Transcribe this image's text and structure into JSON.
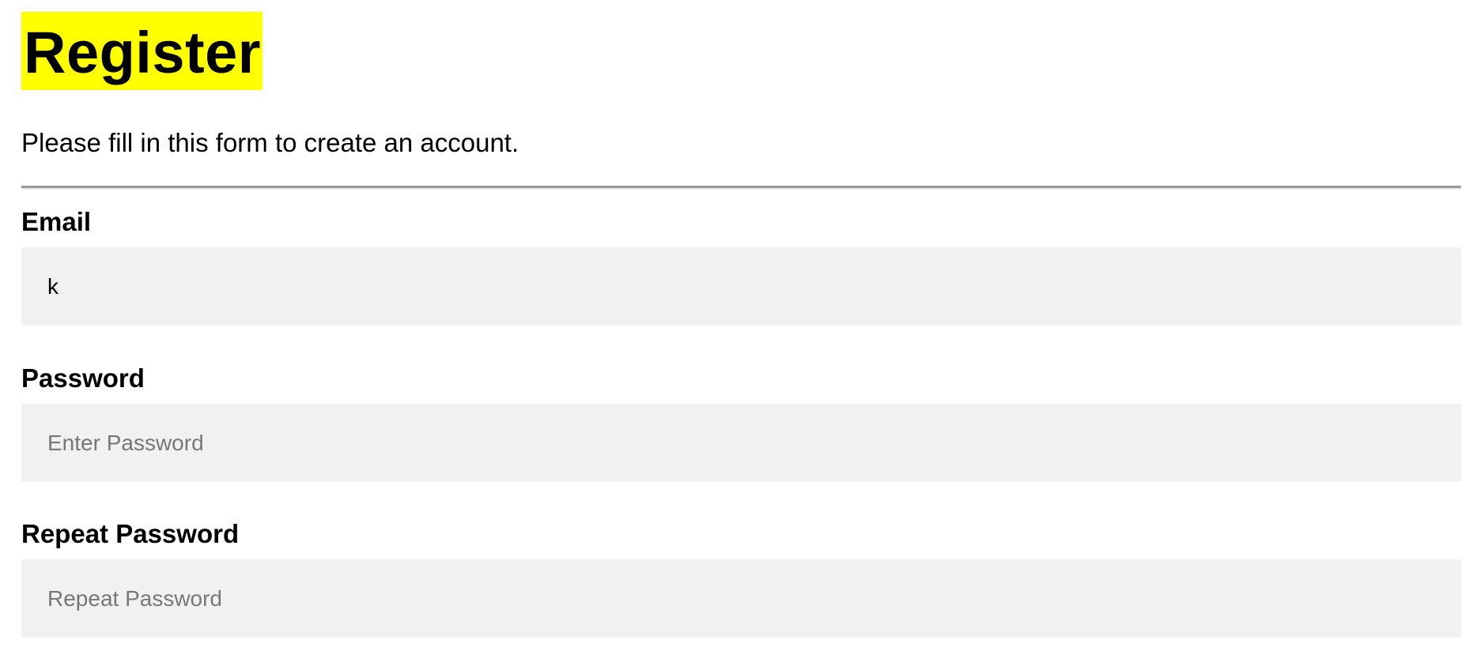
{
  "form": {
    "title": "Register",
    "subtitle": "Please fill in this form to create an account.",
    "colors": {
      "title_highlight": "#ffff00",
      "field_background": "#f1f1f1",
      "placeholder_text": "#777777",
      "divider": "#999999"
    },
    "fields": {
      "email": {
        "label": "Email",
        "value": "k",
        "placeholder": ""
      },
      "password": {
        "label": "Password",
        "value": "",
        "placeholder": "Enter Password"
      },
      "repeat_password": {
        "label": "Repeat Password",
        "value": "",
        "placeholder": "Repeat Password"
      }
    }
  }
}
